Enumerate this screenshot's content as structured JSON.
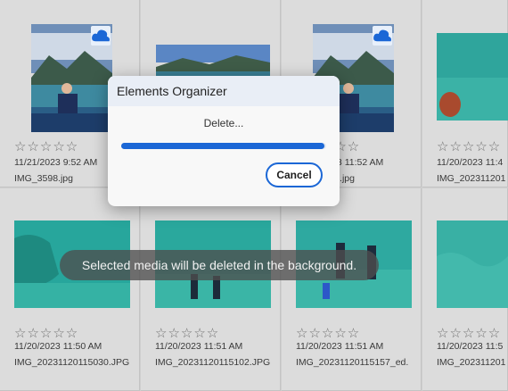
{
  "grid": {
    "row1": [
      {
        "rating_stars": "☆☆☆☆☆",
        "date": "11/21/2023 9:52 AM",
        "filename": "IMG_3598.jpg",
        "cloud": "cloud-icon"
      },
      {
        "rating_stars": "",
        "date": "",
        "filename": ""
      },
      {
        "rating_stars": "☆☆☆☆☆",
        "date": "11/21/2023 11:52 AM",
        "filename": "IMG_3598.jpg",
        "cloud": "cloud-icon"
      },
      {
        "rating_stars": "☆☆☆☆☆",
        "date": "11/20/2023 11:4",
        "filename": "IMG_202311201"
      }
    ],
    "row2": [
      {
        "rating_stars": "☆☆☆☆☆",
        "date": "11/20/2023 11:50 AM",
        "filename": "IMG_20231120115030.JPG"
      },
      {
        "rating_stars": "☆☆☆☆☆",
        "date": "11/20/2023 11:51 AM",
        "filename": "IMG_20231120115102.JPG"
      },
      {
        "rating_stars": "☆☆☆☆☆",
        "date": "11/20/2023 11:51 AM",
        "filename": "IMG_20231120115157_ed."
      },
      {
        "rating_stars": "☆☆☆☆☆",
        "date": "11/20/2023 11:5",
        "filename": "IMG_202311201"
      }
    ]
  },
  "dialog": {
    "title": "Elements Organizer",
    "message": "Delete...",
    "progress_fraction": 0.99,
    "cancel_label": "Cancel"
  },
  "toast": {
    "message": "Selected media will be deleted in the background."
  },
  "colors": {
    "accent": "#1b67d6",
    "grid_bg": "#dcdcdc",
    "cloud_badge": "#1b67d6"
  }
}
